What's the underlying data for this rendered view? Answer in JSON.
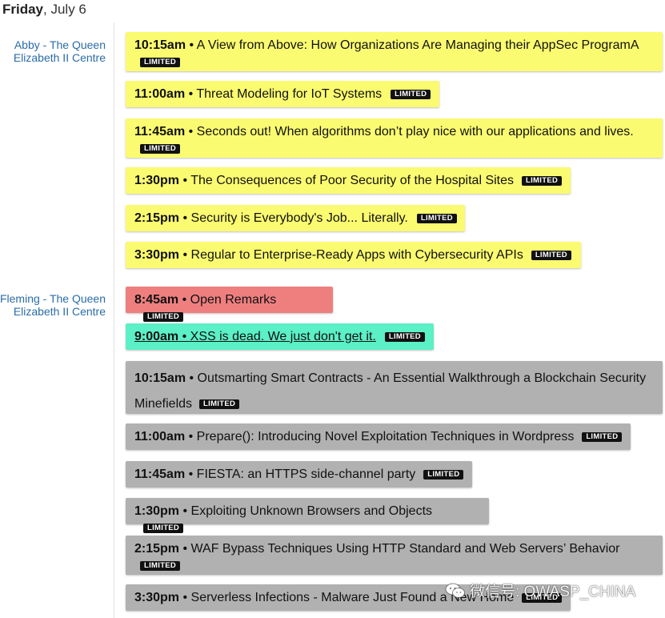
{
  "day": {
    "weekday": "Friday",
    "date": ", July 6"
  },
  "venues": [
    {
      "label": "Abby - The Queen Elizabeth II Centre"
    },
    {
      "label": "Fleming - The Queen Elizabeth II Centre"
    }
  ],
  "badge_label": "LIMITED",
  "events": [
    {
      "time": "10:15am",
      "sep": " • ",
      "title": "A View from Above: How Organizations Are Managing their AppSec ProgramA",
      "color": "#fbfb71"
    },
    {
      "time": "11:00am",
      "sep": " • ",
      "title": "Threat Modeling for IoT Systems",
      "color": "#fbfb71"
    },
    {
      "time": "11:45am",
      "sep": " • ",
      "title": "Seconds out! When algorithms don’t play nice with our applications and lives.",
      "color": "#fbfb71"
    },
    {
      "time": "1:30pm",
      "sep": " • ",
      "title": "The Consequences of Poor Security of the Hospital Sites",
      "color": "#fbfb71"
    },
    {
      "time": "2:15pm",
      "sep": " • ",
      "title": "Security is Everybody's Job... Literally.",
      "color": "#fbfb71"
    },
    {
      "time": "3:30pm",
      "sep": " • ",
      "title": "Regular to Enterprise-Ready Apps with Cybersecurity APIs",
      "color": "#fbfb71"
    },
    {
      "time": "8:45am",
      "sep": " • ",
      "title": "Open Remarks",
      "color": "#ef7f7f"
    },
    {
      "time": "9:00am",
      "sep": " • ",
      "title": "XSS is dead. We just don't get it.",
      "color": "#5bf0c6"
    },
    {
      "time": "10:15am",
      "sep": " • ",
      "title": "Outsmarting Smart Contracts - An Essential Walkthrough a Blockchain Security Minefields",
      "color": "#b1b1b1"
    },
    {
      "time": "11:00am",
      "sep": " • ",
      "title": "Prepare(): Introducing Novel Exploitation Techniques in Wordpress",
      "color": "#b1b1b1"
    },
    {
      "time": "11:45am",
      "sep": " • ",
      "title": "FIESTA: an HTTPS side-channel party",
      "color": "#b1b1b1"
    },
    {
      "time": "1:30pm",
      "sep": " • ",
      "title": "Exploiting Unknown Browsers and Objects",
      "color": "#b1b1b1"
    },
    {
      "time": "2:15pm",
      "sep": " • ",
      "title": "WAF Bypass Techniques Using HTTP Standard and Web Servers’ Behavior",
      "color": "#b1b1b1"
    },
    {
      "time": "3:30pm",
      "sep": " • ",
      "title": "Serverless Infections - Malware Just Found a New Home",
      "color": "#b1b1b1"
    }
  ],
  "watermark": {
    "text": "微信号: OWASP_CHINA",
    "icon": "wechat-icon"
  }
}
